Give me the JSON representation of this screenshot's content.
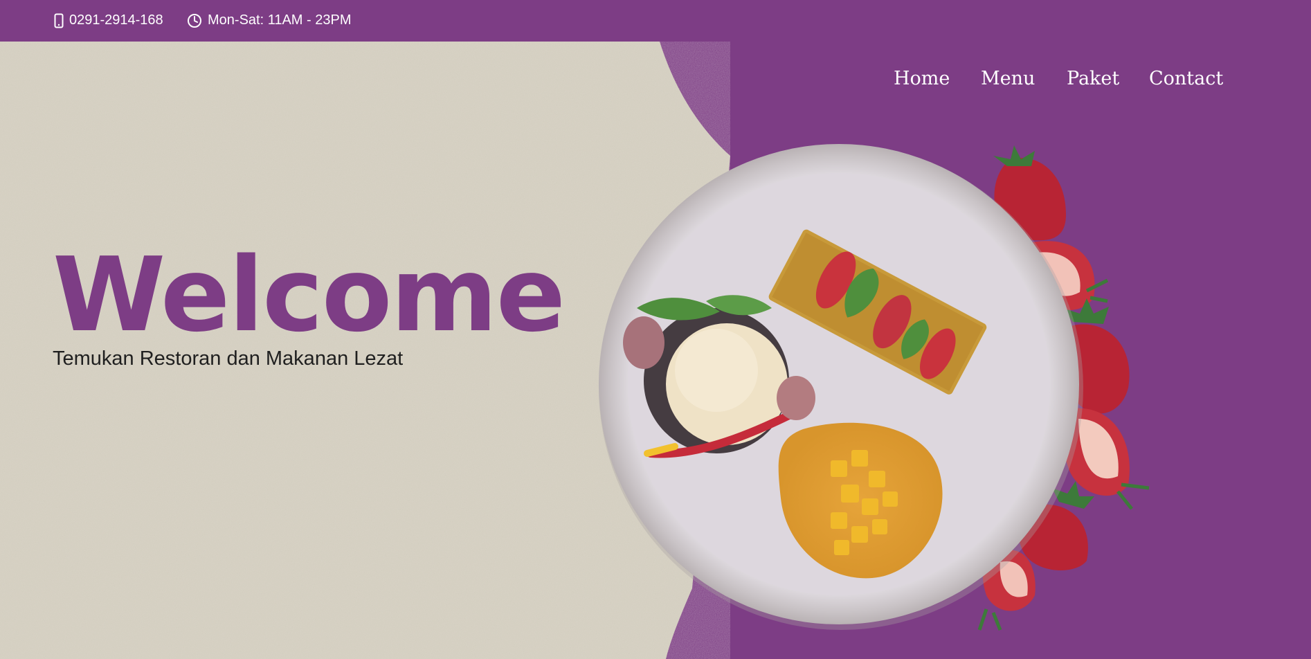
{
  "topbar": {
    "phone": "0291-2914-168",
    "hours": "Mon-Sat: 11AM - 23PM",
    "phone_icon": "phone-icon",
    "clock_icon": "clock-icon"
  },
  "nav": {
    "items": [
      {
        "label": "Home"
      },
      {
        "label": "Menu"
      },
      {
        "label": "Paket"
      },
      {
        "label": "Contact"
      }
    ]
  },
  "hero": {
    "title": "Welcome",
    "subtitle": "Temukan Restoran dan Makanan Lezat",
    "image": "dessert-plate-with-ice-cream-and-strawberries"
  },
  "colors": {
    "brand_purple": "#7d3d85",
    "paper_beige": "#d8d3c6",
    "text_dark": "#1f1f1f"
  }
}
